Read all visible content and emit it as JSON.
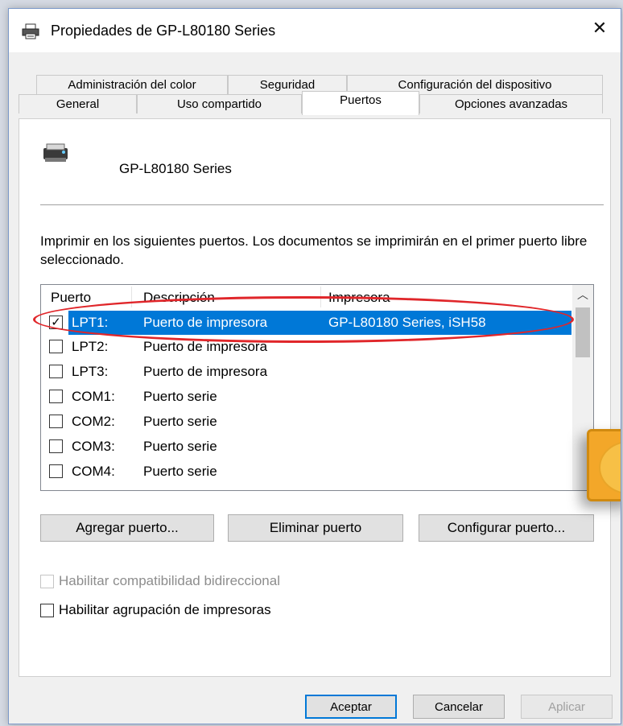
{
  "window": {
    "title": "Propiedades de GP-L80180 Series",
    "close": "✕"
  },
  "tabs": {
    "row1": [
      "Administración del color",
      "Seguridad",
      "Configuración del dispositivo"
    ],
    "row2": [
      "General",
      "Uso compartido",
      "Puertos",
      "Opciones avanzadas"
    ],
    "active": "Puertos"
  },
  "panel": {
    "printer_name": "GP-L80180 Series",
    "description": "Imprimir en los siguientes puertos. Los documentos se imprimirán en el primer puerto libre seleccionado."
  },
  "ports": {
    "headers": [
      "Puerto",
      "Descripción",
      "Impresora"
    ],
    "rows": [
      {
        "port": "LPT1:",
        "desc": "Puerto de impresora",
        "printer": "GP-L80180 Series, iSH58",
        "checked": "✓"
      },
      {
        "port": "LPT2:",
        "desc": "Puerto de impresora",
        "printer": "",
        "checked": ""
      },
      {
        "port": "LPT3:",
        "desc": "Puerto de impresora",
        "printer": "",
        "checked": ""
      },
      {
        "port": "COM1:",
        "desc": "Puerto serie",
        "printer": "",
        "checked": ""
      },
      {
        "port": "COM2:",
        "desc": "Puerto serie",
        "printer": "",
        "checked": ""
      },
      {
        "port": "COM3:",
        "desc": "Puerto serie",
        "printer": "",
        "checked": ""
      },
      {
        "port": "COM4:",
        "desc": "Puerto serie",
        "printer": "",
        "checked": ""
      }
    ]
  },
  "buttons": {
    "add_port": "Agregar puerto...",
    "delete_port": "Eliminar puerto",
    "configure_port": "Configurar puerto..."
  },
  "options": {
    "bidirectional": "Habilitar compatibilidad bidireccional",
    "pooling": "Habilitar agrupación de impresoras"
  },
  "footer": {
    "ok": "Aceptar",
    "cancel": "Cancelar",
    "apply": "Aplicar"
  },
  "colors": {
    "selection": "#0078d7",
    "highlight_oval": "#e0262a",
    "dialog_bg": "#f0f0f0"
  }
}
